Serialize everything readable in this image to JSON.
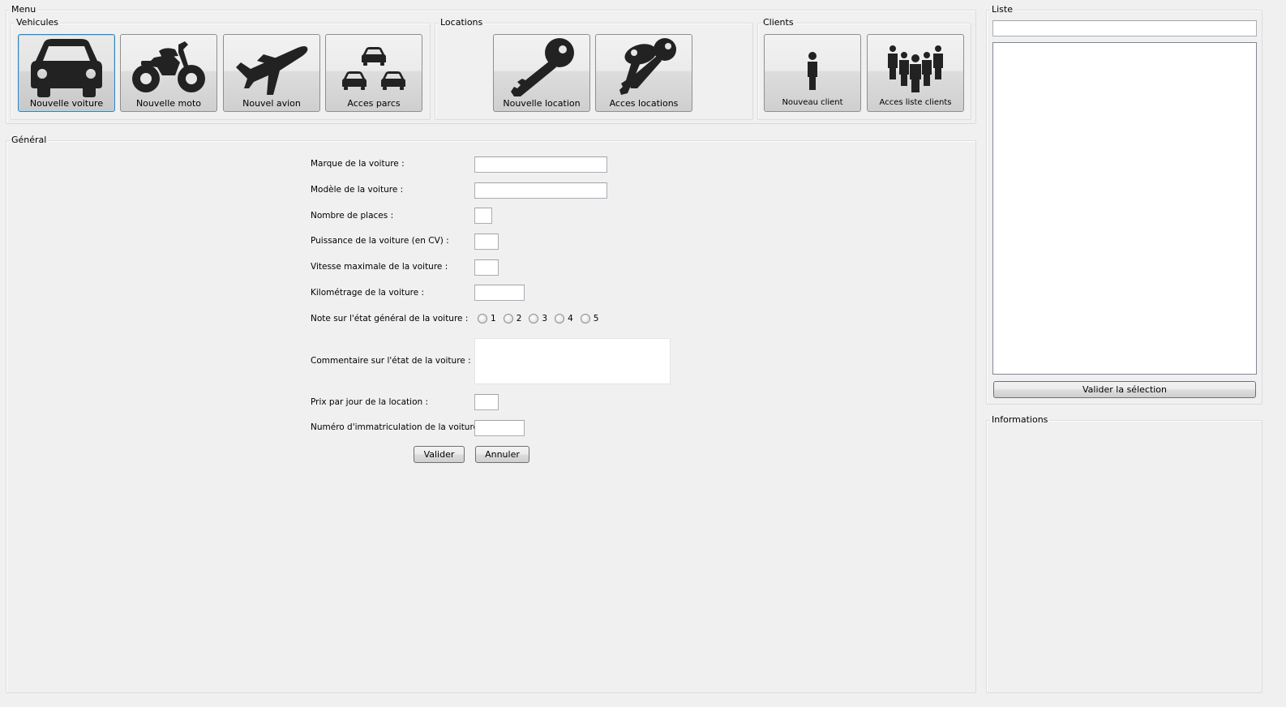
{
  "menu": {
    "title": "Menu",
    "vehicules": {
      "title": "Vehicules",
      "buttons": [
        {
          "label": "Nouvelle voiture",
          "icon": "car-icon",
          "active": true
        },
        {
          "label": "Nouvelle moto",
          "icon": "motorcycle-icon"
        },
        {
          "label": "Nouvel avion",
          "icon": "airplane-icon"
        },
        {
          "label": "Acces parcs",
          "icon": "parking-cars-icon"
        }
      ]
    },
    "locations": {
      "title": "Locations",
      "buttons": [
        {
          "label": "Nouvelle location",
          "icon": "key-icon"
        },
        {
          "label": "Acces locations",
          "icon": "keys-icon"
        }
      ]
    },
    "clients": {
      "title": "Clients",
      "buttons": [
        {
          "label": "Nouveau client",
          "icon": "person-icon"
        },
        {
          "label": "Acces liste clients",
          "icon": "people-group-icon"
        }
      ]
    }
  },
  "general": {
    "title": "Général",
    "fields": {
      "marque": {
        "label": "Marque de la voiture :",
        "value": ""
      },
      "modele": {
        "label": "Modèle de la voiture :",
        "value": ""
      },
      "places": {
        "label": "Nombre de places :",
        "value": ""
      },
      "puissance": {
        "label": "Puissance de la voiture (en CV) :",
        "value": ""
      },
      "vitesse": {
        "label": "Vitesse maximale de la voiture :",
        "value": ""
      },
      "kilometrage": {
        "label": "Kilométrage de la voiture :",
        "value": ""
      },
      "note": {
        "label": "Note sur l'état général de la voiture :",
        "options": [
          "1",
          "2",
          "3",
          "4",
          "5"
        ],
        "selected": null
      },
      "commentaire": {
        "label": "Commentaire sur l'état de la voiture :",
        "value": ""
      },
      "prix": {
        "label": "Prix par jour de la location :",
        "value": ""
      },
      "immatriculation": {
        "label": "Numéro d'immatriculation de la voiture :",
        "value": ""
      }
    },
    "valider_label": "Valider",
    "annuler_label": "Annuler"
  },
  "liste": {
    "title": "Liste",
    "search_value": "",
    "items": [],
    "valider_selection_label": "Valider la sélection"
  },
  "informations": {
    "title": "Informations"
  },
  "colors": {
    "window_bg": "#f0f0f0",
    "icon_fill": "#222222",
    "active_border": "#3c7fb1"
  }
}
